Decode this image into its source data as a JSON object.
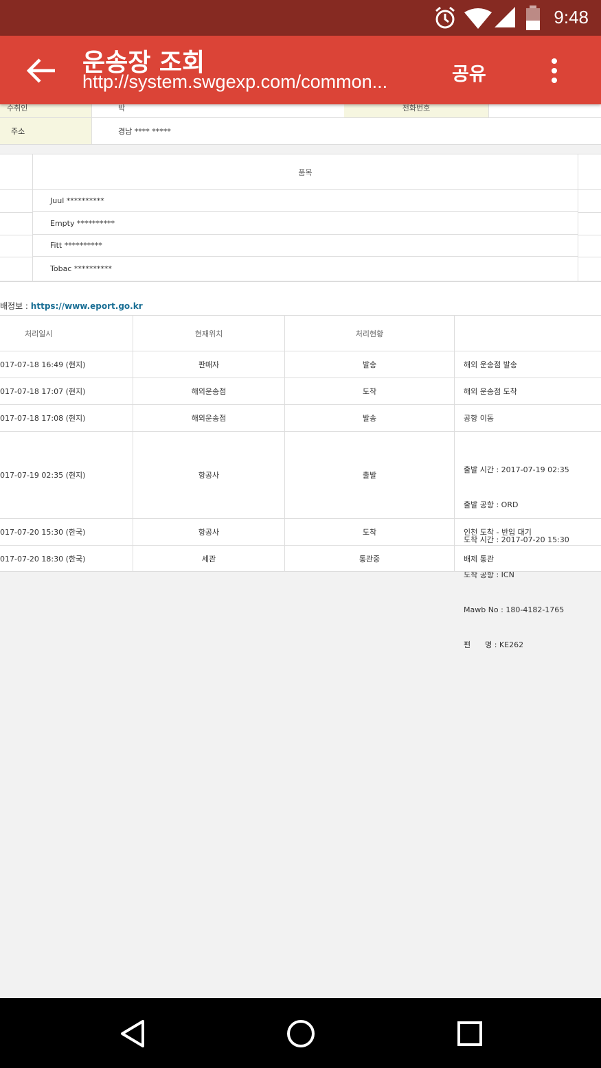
{
  "status_bar": {
    "time": "9:48",
    "icons": [
      "alarm-icon",
      "wifi-icon",
      "signal-icon",
      "battery-icon"
    ]
  },
  "app_bar": {
    "title": "운송장 조회",
    "url": "http://system.swgexp.com/common...",
    "share_label": "공유",
    "back_icon": "arrow-back-icon",
    "menu_icon": "more-vert-icon"
  },
  "recipient": {
    "top_partial_label": "수취인",
    "top_partial_value": "박",
    "top_partial_label2": "전화번호",
    "address_label": "주소",
    "address_value": "경남 **** *****"
  },
  "items": {
    "header": "품목",
    "rows": [
      "Juul **********",
      "Empty **********",
      "Fitt **********",
      "Tobac **********"
    ]
  },
  "tracking": {
    "link_prefix": "배정보 : ",
    "link_text": "https://www.eport.go.kr",
    "headers": [
      "처리일시",
      "현재위치",
      "처리현황",
      ""
    ],
    "rows": [
      {
        "datetime": "017-07-18 16:49 (현지)",
        "location": "판매자",
        "status": "발송",
        "detail": [
          "해외 운송점 발송"
        ]
      },
      {
        "datetime": "017-07-18 17:07 (현지)",
        "location": "해외운송점",
        "status": "도착",
        "detail": [
          "해외 운송점 도착"
        ]
      },
      {
        "datetime": "017-07-18 17:08 (현지)",
        "location": "해외운송점",
        "status": "발송",
        "detail": [
          "공항 이동"
        ]
      },
      {
        "datetime": "017-07-19 02:35 (현지)",
        "location": "항공사",
        "status": "출발",
        "detail": [
          "출발 시간 : 2017-07-19 02:35",
          "출발 공항 : ORD",
          "도착 시간 : 2017-07-20 15:30",
          "도착 공항 : ICN",
          "Mawb No : 180-4182-1765",
          "편      명 : KE262"
        ]
      },
      {
        "datetime": "017-07-20 15:30 (한국)",
        "location": "항공사",
        "status": "도착",
        "detail": [
          "인천 도착 - 반입 대기"
        ]
      },
      {
        "datetime": "017-07-20 18:30 (한국)",
        "location": "세관",
        "status": "통관중",
        "detail": [
          "배제 통관"
        ]
      }
    ]
  },
  "nav_bar": {
    "icons": [
      "back-triangle-icon",
      "home-circle-icon",
      "recents-square-icon"
    ]
  }
}
